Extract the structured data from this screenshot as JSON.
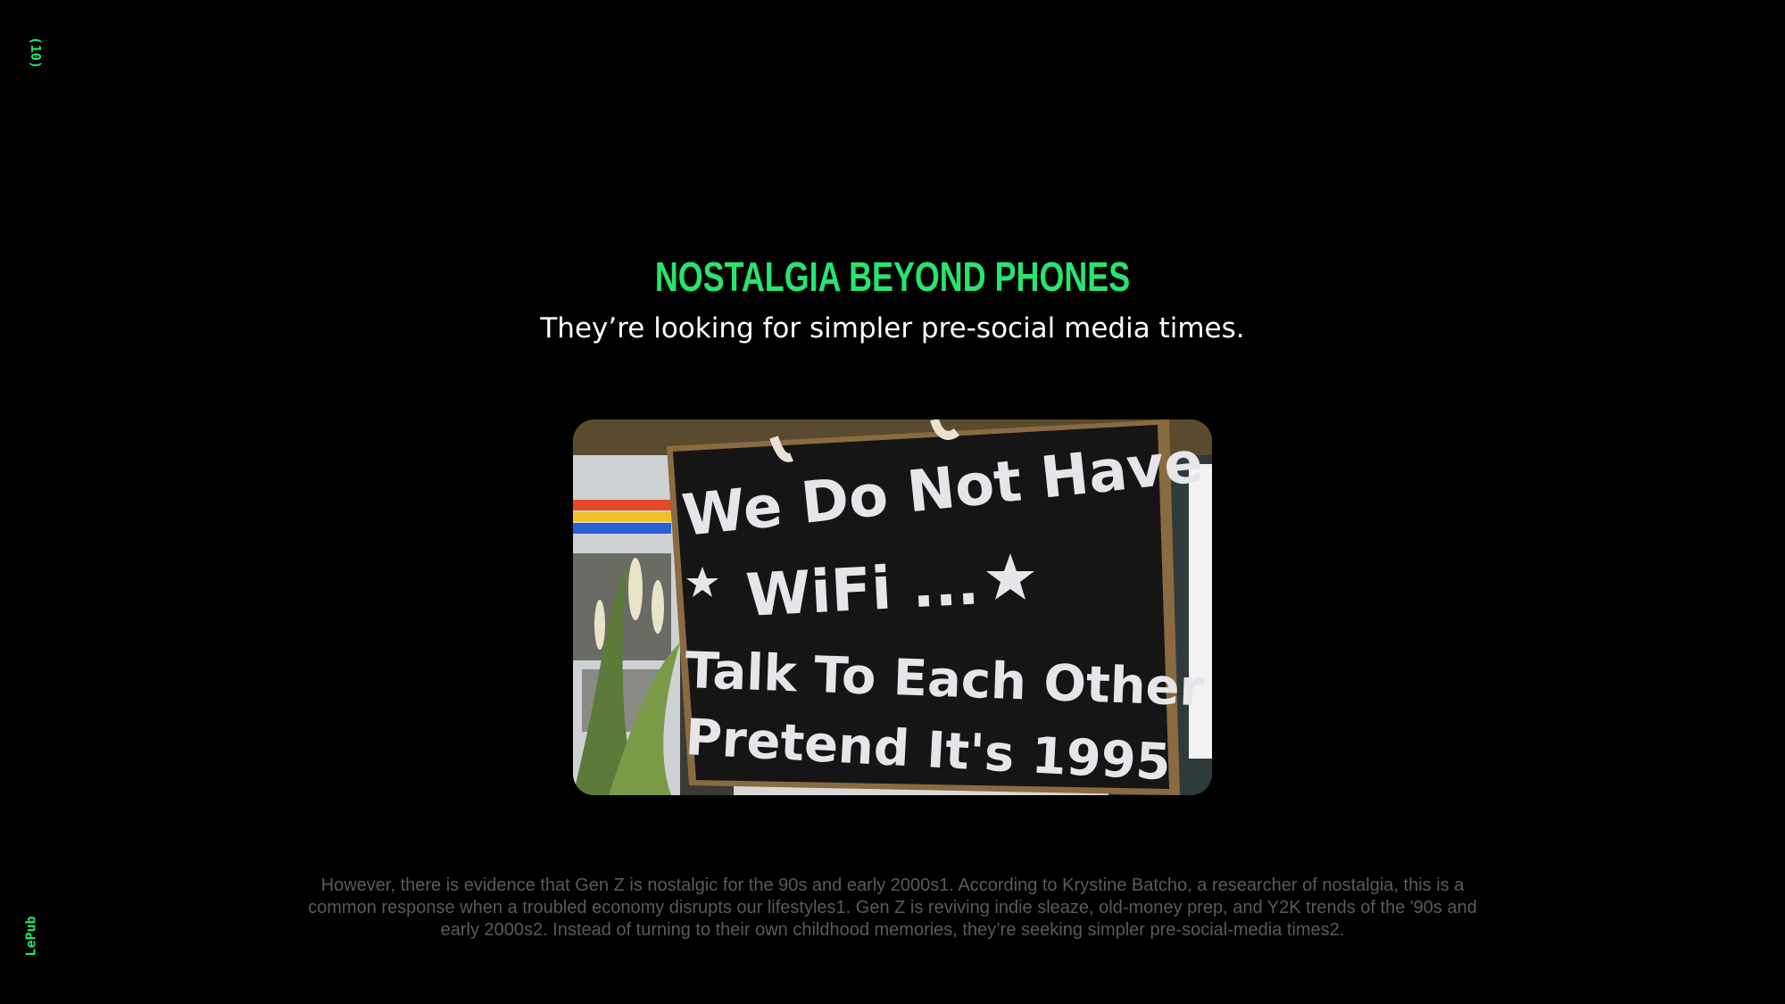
{
  "page": {
    "number": "(10)",
    "brand": "LePub"
  },
  "header": {
    "title": "NOSTALGIA BEYOND PHONES",
    "subtitle": "They’re looking for simpler pre-social media times."
  },
  "photo": {
    "sign_lines": [
      "We Do Not Have",
      "WiFi ...",
      "Talk To Each Other",
      "Pretend It's 1995"
    ]
  },
  "body": {
    "text": "However, there is evidence that Gen Z is nostalgic for the 90s and early 2000s1. According to Krystine Batcho, a researcher of nostalgia, this is a common response when a troubled economy disrupts our lifestyles1. Gen Z is reviving indie sleaze, old-money prep, and Y2K trends of the '90s and early 2000s2. Instead of turning to their own childhood memories, they’re seeking simpler pre-social-media times2."
  },
  "colors": {
    "accent": "#27e56e",
    "background": "#000000",
    "body_text": "#5a5a5a"
  }
}
